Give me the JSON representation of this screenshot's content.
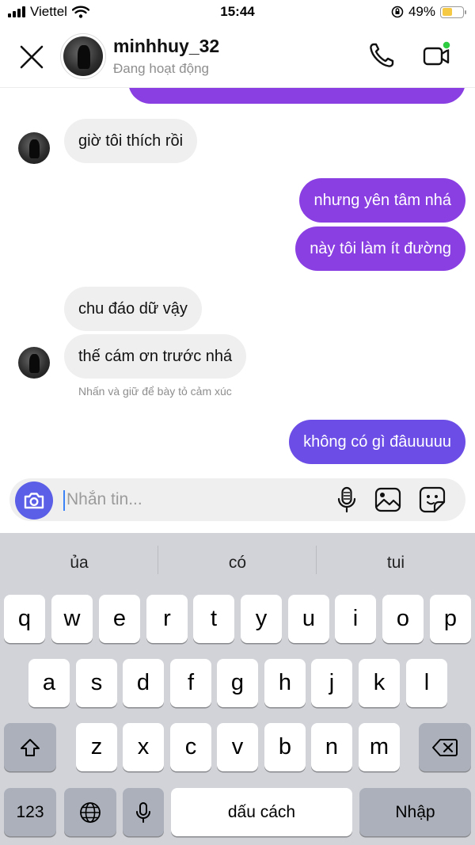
{
  "status_bar": {
    "carrier": "Viettel",
    "time": "15:44",
    "battery": "49%",
    "battery_level": 0.49
  },
  "header": {
    "username": "minhhuy_32",
    "status": "Đang hoạt động"
  },
  "messages": [
    {
      "text": "giờ tôi thích rồi"
    },
    {
      "text": "nhưng yên tâm nhá"
    },
    {
      "text": "này tôi làm ít đường"
    },
    {
      "text": "chu đáo dữ vậy"
    },
    {
      "text": "thế cám ơn trước nhá"
    },
    {
      "text": "không có gì đâuuuuu"
    }
  ],
  "reaction_hint": "Nhấn và giữ để bày tỏ cảm xúc",
  "composer": {
    "placeholder": "Nhắn tin..."
  },
  "keyboard": {
    "suggestions": [
      "ủa",
      "có",
      "tui"
    ],
    "row1": [
      "q",
      "w",
      "e",
      "r",
      "t",
      "y",
      "u",
      "i",
      "o",
      "p"
    ],
    "row2": [
      "a",
      "s",
      "d",
      "f",
      "g",
      "h",
      "j",
      "k",
      "l"
    ],
    "row3": [
      "z",
      "x",
      "c",
      "v",
      "b",
      "n",
      "m"
    ],
    "numbers_key": "123",
    "space_key": "dấu cách",
    "return_key": "Nhập"
  },
  "colors": {
    "incoming_bubble": "#efefef",
    "outgoing_purple": "#8a3fe3",
    "outgoing_violet": "#6c4ee6",
    "camera_button": "#5b5ee6",
    "keyboard_bg": "#d1d3d9",
    "online_dot": "#2ecc40"
  }
}
